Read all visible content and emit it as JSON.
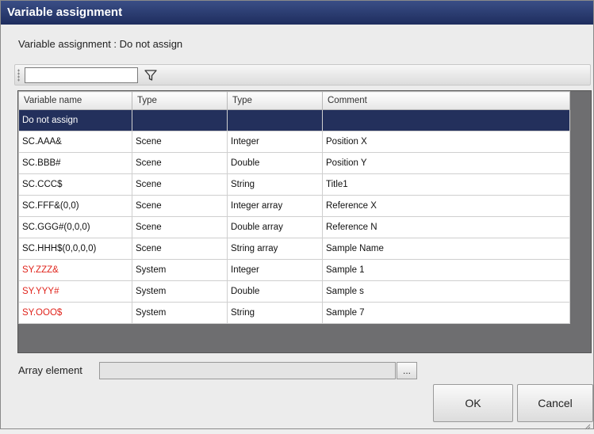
{
  "window": {
    "title": "Variable assignment"
  },
  "subtitle": "Variable assignment : Do not assign",
  "filter": {
    "value": "",
    "icon": "filter-icon"
  },
  "table": {
    "headers": [
      "Variable name",
      "Type",
      "Type",
      "Comment"
    ],
    "rows": [
      {
        "name": "Do not assign",
        "type1": "",
        "type2": "",
        "comment": "",
        "selected": true,
        "system": false
      },
      {
        "name": "SC.AAA&",
        "type1": "Scene",
        "type2": "Integer",
        "comment": "Position X",
        "selected": false,
        "system": false
      },
      {
        "name": "SC.BBB#",
        "type1": "Scene",
        "type2": "Double",
        "comment": "Position Y",
        "selected": false,
        "system": false
      },
      {
        "name": "SC.CCC$",
        "type1": "Scene",
        "type2": "String",
        "comment": "Title1",
        "selected": false,
        "system": false
      },
      {
        "name": "SC.FFF&(0,0)",
        "type1": "Scene",
        "type2": "Integer array",
        "comment": "Reference X",
        "selected": false,
        "system": false
      },
      {
        "name": "SC.GGG#(0,0,0)",
        "type1": "Scene",
        "type2": "Double array",
        "comment": "Reference N",
        "selected": false,
        "system": false
      },
      {
        "name": "SC.HHH$(0,0,0,0)",
        "type1": "Scene",
        "type2": "String array",
        "comment": "Sample Name",
        "selected": false,
        "system": false
      },
      {
        "name": "SY.ZZZ&",
        "type1": "System",
        "type2": "Integer",
        "comment": "Sample 1",
        "selected": false,
        "system": true
      },
      {
        "name": "SY.YYY#",
        "type1": "System",
        "type2": "Double",
        "comment": "Sample s",
        "selected": false,
        "system": true
      },
      {
        "name": "SY.OOO$",
        "type1": "System",
        "type2": "String",
        "comment": "Sample 7",
        "selected": false,
        "system": true
      }
    ]
  },
  "array_element": {
    "label": "Array element",
    "value": "",
    "browse_label": "..."
  },
  "buttons": {
    "ok": "OK",
    "cancel": "Cancel"
  },
  "colors": {
    "titlebar": "#1e2d5e",
    "selected_row": "#23305c",
    "system_text": "#e0241c",
    "grid_background": "#6e6e70"
  }
}
